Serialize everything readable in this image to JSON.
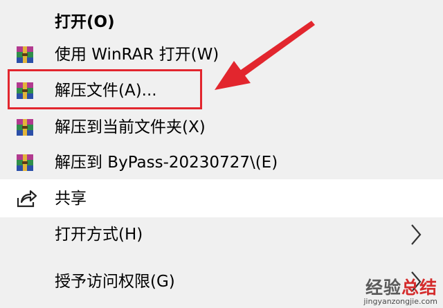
{
  "menu": {
    "items": [
      {
        "label": "打开(O)",
        "icon": "none"
      },
      {
        "label": "使用 WinRAR 打开(W)",
        "icon": "winrar-icon"
      },
      {
        "label": "解压文件(A)...",
        "icon": "winrar-icon"
      },
      {
        "label": "解压到当前文件夹(X)",
        "icon": "winrar-icon"
      },
      {
        "label": "解压到 ByPass-20230727\\(E)",
        "icon": "winrar-icon"
      },
      {
        "label": "共享",
        "icon": "share-icon"
      },
      {
        "label": "打开方式(H)",
        "icon": "chevron-right-icon"
      },
      {
        "label": "授予访问权限(G)",
        "icon": "chevron-right-icon"
      }
    ]
  },
  "annotation": {
    "highlight_color": "#e2262e"
  },
  "watermark": {
    "main_a": "经验",
    "main_b": "总结",
    "sub": "jingyanzongjie.com"
  }
}
